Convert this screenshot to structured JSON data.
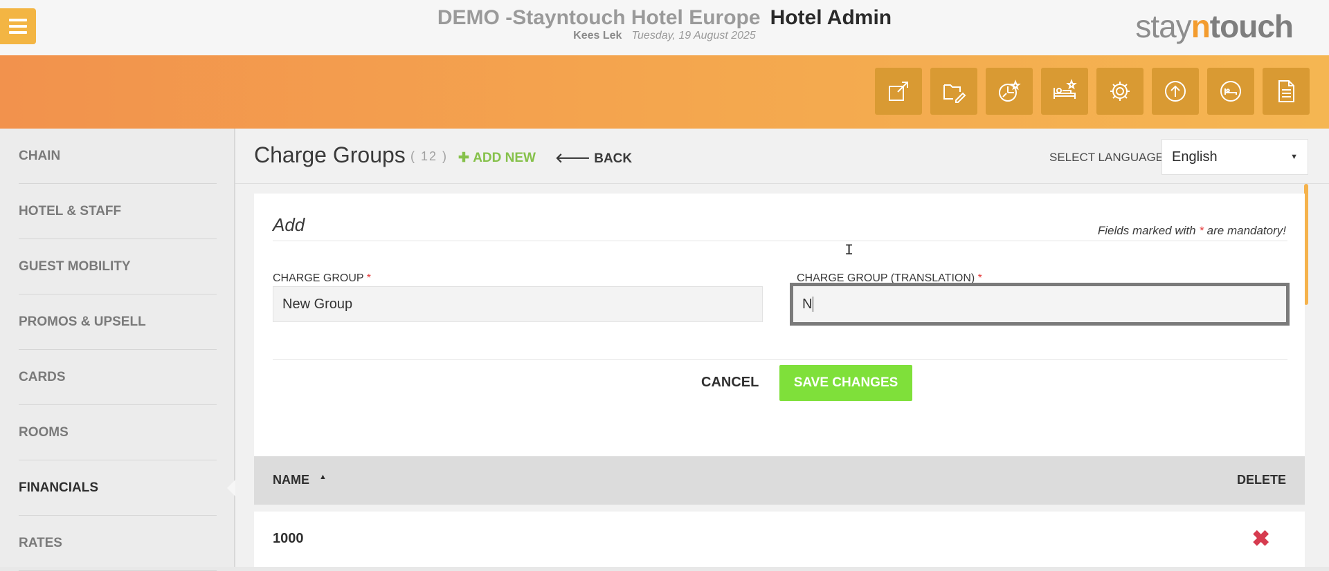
{
  "header": {
    "hotel_name": "DEMO -Stayntouch Hotel Europe",
    "app_name": "Hotel Admin",
    "user_name": "Kees Lek",
    "date": "Tuesday, 19 August 2025",
    "logo": {
      "part1": "stay",
      "part2": "n",
      "part3": "touch"
    }
  },
  "toolbar_icons": [
    "external-link-icon",
    "folder-edit-icon",
    "chart-star-icon",
    "bed-star-icon",
    "gear-icon",
    "upload-icon",
    "bed-circle-icon",
    "document-icon"
  ],
  "sidebar": {
    "items": [
      {
        "label": "CHAIN"
      },
      {
        "label": "HOTEL & STAFF"
      },
      {
        "label": "GUEST MOBILITY"
      },
      {
        "label": "PROMOS & UPSELL"
      },
      {
        "label": "CARDS"
      },
      {
        "label": "ROOMS"
      },
      {
        "label": "FINANCIALS",
        "active": true
      },
      {
        "label": "RATES"
      }
    ]
  },
  "page": {
    "title": "Charge Groups",
    "count": "( 12 )",
    "add_new": "ADD NEW",
    "back": "BACK",
    "language_label": "SELECT LANGUAGE",
    "language_value": "English"
  },
  "form": {
    "heading": "Add",
    "mandatory_prefix": "Fields marked with ",
    "mandatory_star": "*",
    "mandatory_suffix": " are mandatory!",
    "charge_group_label": "CHARGE GROUP",
    "charge_group_value": "New Group",
    "translation_label": "CHARGE GROUP (TRANSLATION)",
    "translation_value": "N",
    "required_marker": "*",
    "cancel": "CANCEL",
    "save": "SAVE CHANGES"
  },
  "table": {
    "col_name": "NAME",
    "col_delete": "DELETE",
    "rows": [
      {
        "name": "1000"
      }
    ]
  },
  "colors": {
    "accent_orange": "#f4a64e",
    "save_green": "#7fe03a",
    "add_green": "#86c14b",
    "required_red": "#e53b3b",
    "delete_red": "#d63b4f"
  }
}
